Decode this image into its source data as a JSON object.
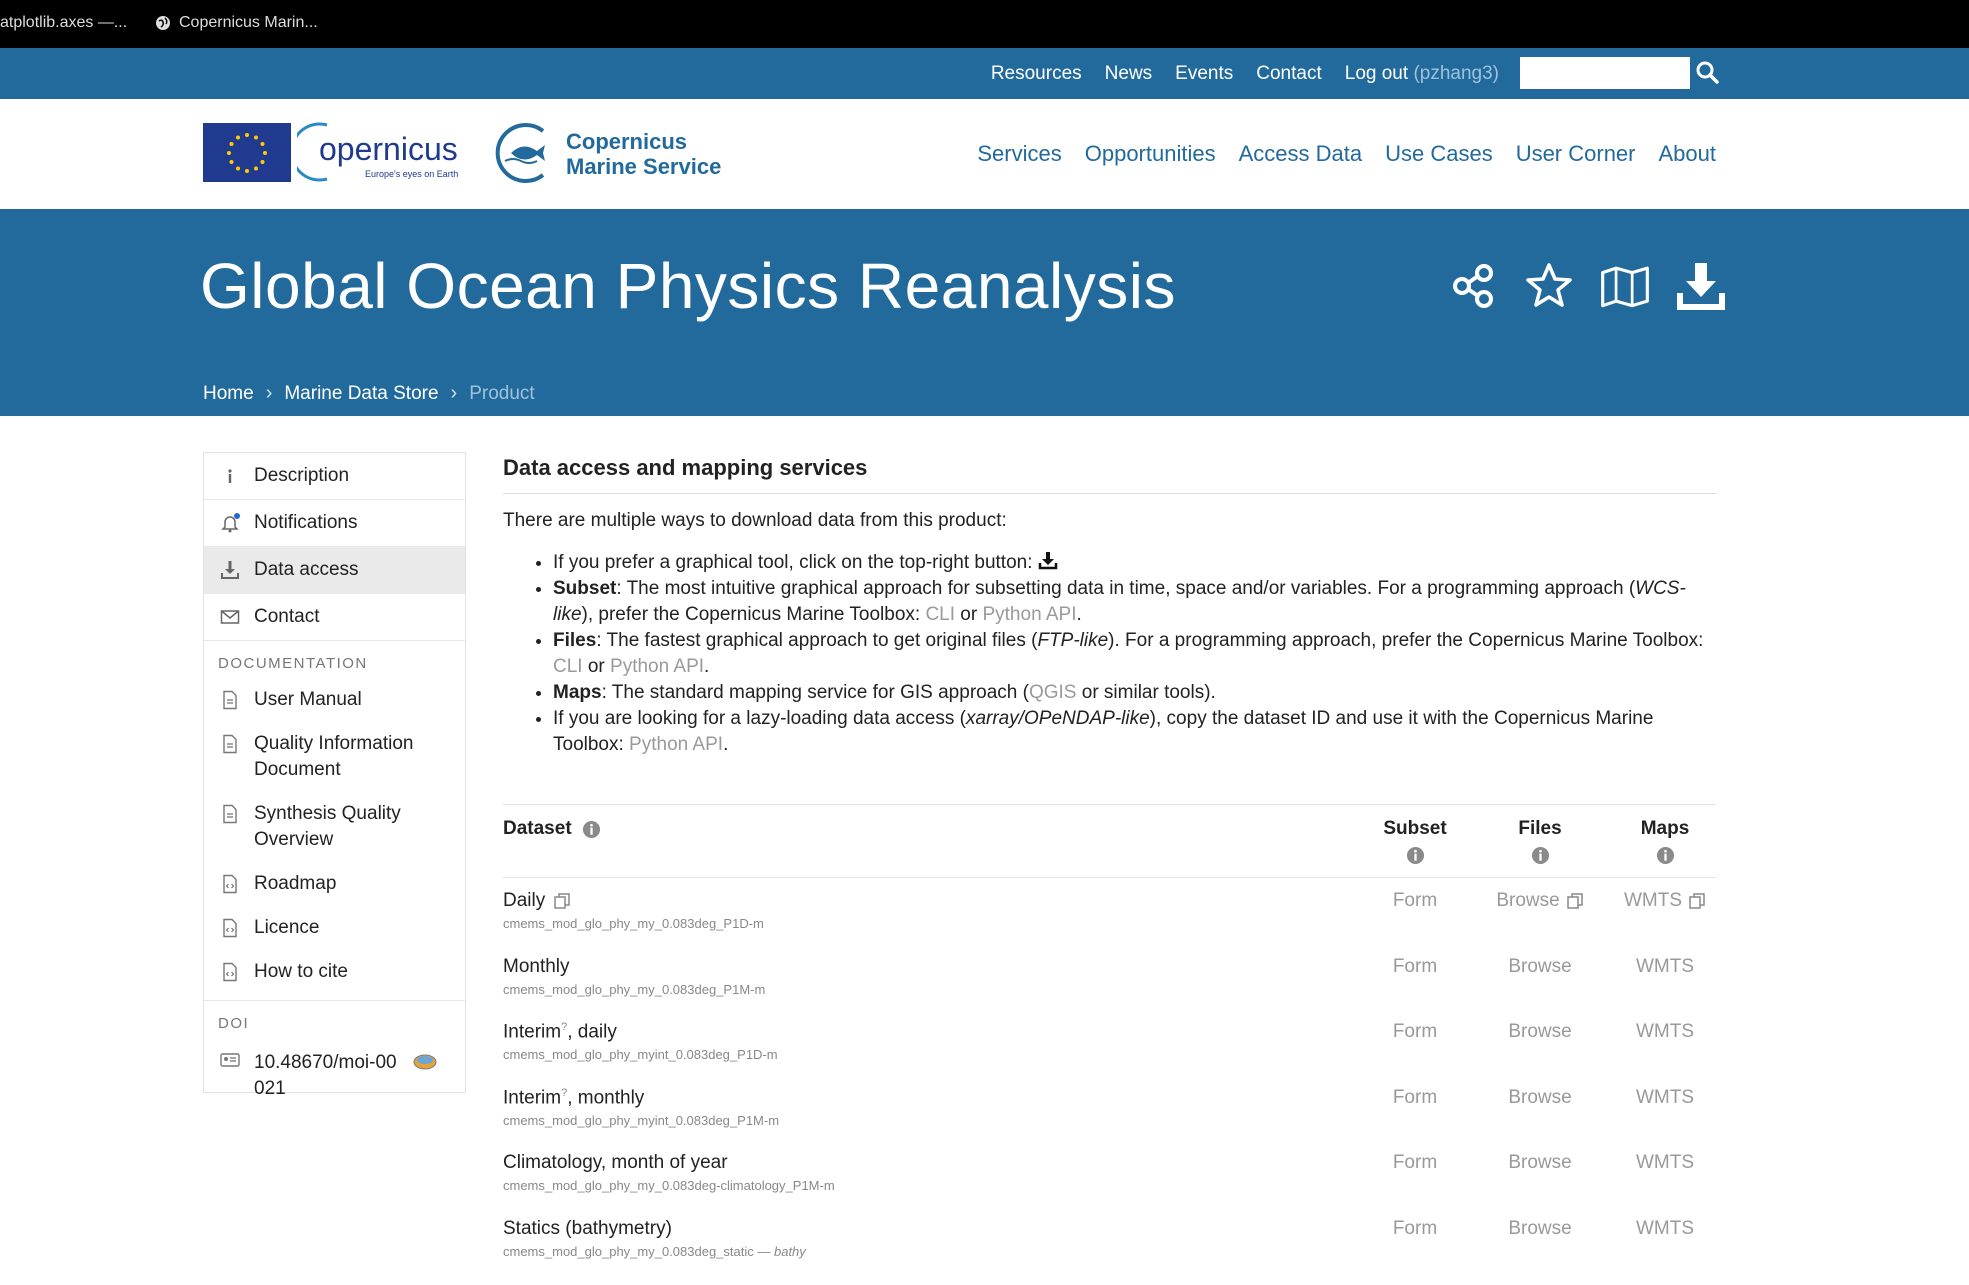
{
  "browser": {
    "tabs": [
      {
        "title": "atplotlib.axes —..."
      },
      {
        "title": "Copernicus Marin..."
      }
    ]
  },
  "utility_nav": {
    "items": [
      "Resources",
      "News",
      "Events",
      "Contact"
    ],
    "logout": "Log out",
    "user": "(pzhang3)",
    "search_placeholder": ""
  },
  "header": {
    "copernicus_word": "opernicus",
    "copernicus_tagline": "Europe's eyes on Earth",
    "cms_line1": "Copernicus",
    "cms_line2": "Marine Service",
    "nav": [
      "Services",
      "Opportunities",
      "Access Data",
      "Use Cases",
      "User Corner",
      "About"
    ]
  },
  "banner": {
    "title": "Global Ocean Physics Reanalysis",
    "icons": [
      "share-icon",
      "star-icon",
      "map-icon",
      "download-icon"
    ],
    "breadcrumb": [
      "Home",
      "Marine Data Store",
      "Product"
    ]
  },
  "sidebar": {
    "items": [
      {
        "label": "Description",
        "icon": "info-icon"
      },
      {
        "label": "Notifications",
        "icon": "bell-icon"
      },
      {
        "label": "Data access",
        "icon": "download-icon"
      },
      {
        "label": "Contact",
        "icon": "envelope-icon"
      }
    ],
    "documentation_heading": "DOCUMENTATION",
    "docs": [
      "User Manual",
      "Quality Information Document",
      "Synthesis Quality Overview",
      "Roadmap",
      "Licence",
      "How to cite"
    ],
    "doi_heading": "DOI",
    "doi": "10.48670/moi-00021"
  },
  "main": {
    "heading": "Data access and mapping services",
    "intro": "There are multiple ways to download data from this product:",
    "b1": "If you prefer a graphical tool, click on the top-right button:",
    "b2_label": "Subset",
    "b2_text1": ": The most intuitive graphical approach for subsetting data in time, space and/or variables. For a programming approach (",
    "b2_em": "WCS-like",
    "b2_text2": "), prefer the Copernicus Marine Toolbox: ",
    "cli": "CLI",
    "or": " or ",
    "python_api": "Python API",
    "b3_label": "Files",
    "b3_text1": ": The fastest graphical approach to get original files (",
    "b3_em": "FTP-like",
    "b3_text2": "). For a programming approach, prefer the Copernicus Marine Toolbox: ",
    "b4_label": "Maps",
    "b4_text1": ": The standard mapping service for GIS approach (",
    "qgis": "QGIS",
    "b4_text2": " or similar tools).",
    "b5_text1": "If you are looking for a lazy-loading data access (",
    "b5_em": "xarray/OPeNDAP-like",
    "b5_text2": "), copy the dataset ID and use it with the Copernicus Marine Toolbox: "
  },
  "table": {
    "headers": {
      "dataset": "Dataset",
      "subset": "Subset",
      "files": "Files",
      "maps": "Maps"
    },
    "rows": [
      {
        "name": "Daily",
        "sup": "",
        "id": "cmems_mod_glo_phy_my_0.083deg_P1D-m",
        "subset": "Form",
        "files": "Browse",
        "maps": "WMTS"
      },
      {
        "name": "Monthly",
        "sup": "",
        "id": "cmems_mod_glo_phy_my_0.083deg_P1M-m",
        "subset": "Form",
        "files": "Browse",
        "maps": "WMTS"
      },
      {
        "name": "Interim",
        "sup": "?",
        "name_suffix": ", daily",
        "id": "cmems_mod_glo_phy_myint_0.083deg_P1D-m",
        "subset": "Form",
        "files": "Browse",
        "maps": "WMTS"
      },
      {
        "name": "Interim",
        "sup": "?",
        "name_suffix": ", monthly",
        "id": "cmems_mod_glo_phy_myint_0.083deg_P1M-m",
        "subset": "Form",
        "files": "Browse",
        "maps": "WMTS"
      },
      {
        "name": "Climatology, month of year",
        "sup": "",
        "id": "cmems_mod_glo_phy_my_0.083deg-climatology_P1M-m",
        "subset": "Form",
        "files": "Browse",
        "maps": "WMTS"
      },
      {
        "name": "Statics (bathymetry)",
        "sup": "",
        "id": "cmems_mod_glo_phy_my_0.083deg_static",
        "id_suffix": " — bathy",
        "subset": "Form",
        "files": "Browse",
        "maps": "WMTS"
      }
    ]
  },
  "colors": {
    "brand_blue": "#236a9c",
    "link_grey": "#9a9a9a"
  }
}
